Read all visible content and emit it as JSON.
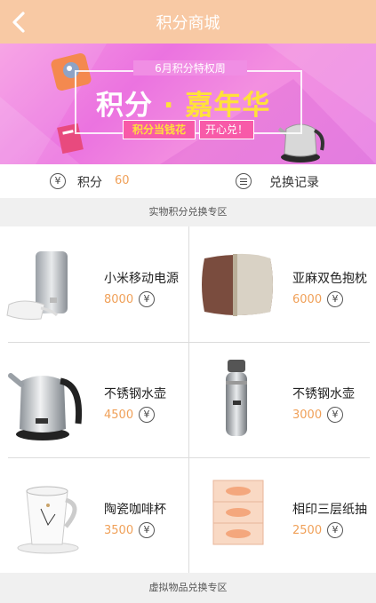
{
  "header": {
    "title": "积分商城",
    "back_icon": "chevron-left-icon"
  },
  "banner": {
    "subtitle": "6月积分特权周",
    "title_part1": "积分",
    "title_dot": "·",
    "title_part2": "嘉年华",
    "pill_left": "积分当钱花",
    "pill_right": "开心兑！"
  },
  "points_bar": {
    "points_label": "积分",
    "points_value": "60",
    "yen_symbol": "¥",
    "record_label": "兑换记录"
  },
  "section_physical": "实物积分兑换专区",
  "section_virtual": "虚拟物品兑换专区",
  "products": [
    {
      "name": "小米移动电源",
      "price": "8000",
      "icon": "power-bank-image"
    },
    {
      "name": "亚麻双色抱枕",
      "price": "6000",
      "icon": "pillow-image"
    },
    {
      "name": "不锈钢水壶",
      "price": "4500",
      "icon": "electric-kettle-image"
    },
    {
      "name": "不锈钢水壶",
      "price": "3000",
      "icon": "thermos-bottle-image"
    },
    {
      "name": "陶瓷咖啡杯",
      "price": "3500",
      "icon": "coffee-mug-image"
    },
    {
      "name": "相印三层纸抽",
      "price": "2500",
      "icon": "tissue-box-image"
    }
  ],
  "colors": {
    "header": "#f8c9a4",
    "price": "#f0a058",
    "banner": "#eb73e0"
  }
}
